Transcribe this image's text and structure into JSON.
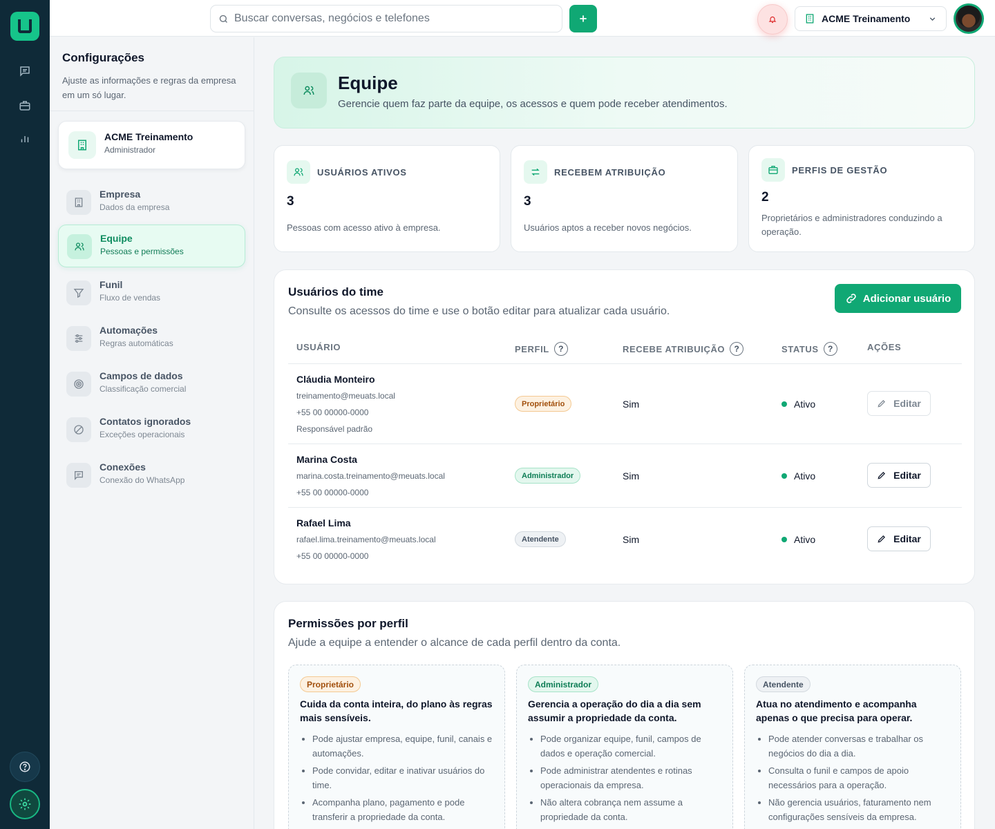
{
  "search": {
    "placeholder": "Buscar conversas, negócios e telefones"
  },
  "topbar": {
    "company_name": "ACME Treinamento"
  },
  "sidebar": {
    "title": "Configurações",
    "description": "Ajuste as informações e regras da empresa em um só lugar.",
    "account": {
      "name": "ACME Treinamento",
      "role": "Administrador"
    },
    "items": [
      {
        "label": "Empresa",
        "sub": "Dados da empresa",
        "icon": "building-icon"
      },
      {
        "label": "Equipe",
        "sub": "Pessoas e permissões",
        "icon": "users-icon"
      },
      {
        "label": "Funil",
        "sub": "Fluxo de vendas",
        "icon": "filter-icon"
      },
      {
        "label": "Automações",
        "sub": "Regras automáticas",
        "icon": "sliders-icon"
      },
      {
        "label": "Campos de dados",
        "sub": "Classificação comercial",
        "icon": "target-icon"
      },
      {
        "label": "Contatos ignorados",
        "sub": "Exceções operacionais",
        "icon": "block-icon"
      },
      {
        "label": "Conexões",
        "sub": "Conexão do WhatsApp",
        "icon": "message-icon"
      }
    ]
  },
  "hero": {
    "title": "Equipe",
    "description": "Gerencie quem faz parte da equipe, os acessos e quem pode receber atendimentos."
  },
  "stats": [
    {
      "label": "USUÁRIOS ATIVOS",
      "value": "3",
      "description": "Pessoas com acesso ativo à empresa."
    },
    {
      "label": "RECEBEM ATRIBUIÇÃO",
      "value": "3",
      "description": "Usuários aptos a receber novos negócios."
    },
    {
      "label": "PERFIS DE GESTÃO",
      "value": "2",
      "description": "Proprietários e administradores conduzindo a operação."
    }
  ],
  "users_card": {
    "title": "Usuários do time",
    "description": "Consulte os acessos do time e use o botão editar para atualizar cada usuário.",
    "add_label": "Adicionar usuário",
    "columns": [
      "USUÁRIO",
      "PERFIL",
      "RECEBE ATRIBUIÇÃO",
      "STATUS",
      "AÇÕES"
    ],
    "help_mark": "?",
    "rows": [
      {
        "name": "Cláudia Monteiro",
        "email": "treinamento@meuats.local",
        "phone": "+55 00 00000-0000",
        "note": "Responsável padrão",
        "role": "Proprietário",
        "assign": "Sim",
        "status": "Ativo",
        "action": "Editar"
      },
      {
        "name": "Marina Costa",
        "email": "marina.costa.treinamento@meuats.local",
        "phone": "+55 00 00000-0000",
        "role": "Administrador",
        "assign": "Sim",
        "status": "Ativo",
        "action": "Editar"
      },
      {
        "name": "Rafael Lima",
        "email": "rafael.lima.treinamento@meuats.local",
        "phone": "+55 00 00000-0000",
        "role": "Atendente",
        "assign": "Sim",
        "status": "Ativo",
        "action": "Editar"
      }
    ]
  },
  "perms_card": {
    "title": "Permissões por perfil",
    "description": "Ajude a equipe a entender o alcance de cada perfil dentro da conta.",
    "profiles": [
      {
        "badge": "Proprietário",
        "heading": "Cuida da conta inteira, do plano às regras mais sensíveis.",
        "items": [
          "Pode ajustar empresa, equipe, funil, canais e automações.",
          "Pode convidar, editar e inativar usuários do time.",
          "Acompanha plano, pagamento e pode transferir a propriedade da conta."
        ]
      },
      {
        "badge": "Administrador",
        "heading": "Gerencia a operação do dia a dia sem assumir a propriedade da conta.",
        "items": [
          "Pode organizar equipe, funil, campos de dados e operação comercial.",
          "Pode administrar atendentes e rotinas operacionais da empresa.",
          "Não altera cobrança nem assume a propriedade da conta."
        ]
      },
      {
        "badge": "Atendente",
        "heading": "Atua no atendimento e acompanha apenas o que precisa para operar.",
        "items": [
          "Pode atender conversas e trabalhar os negócios do dia a dia.",
          "Consulta o funil e campos de apoio necessários para a operação.",
          "Não gerencia usuários, faturamento nem configurações sensíveis da empresa."
        ]
      }
    ]
  },
  "colors": {
    "primary": "#10a874",
    "rail": "#0f2a38",
    "owner": "#a14f0c",
    "admin": "#0d7d55"
  }
}
